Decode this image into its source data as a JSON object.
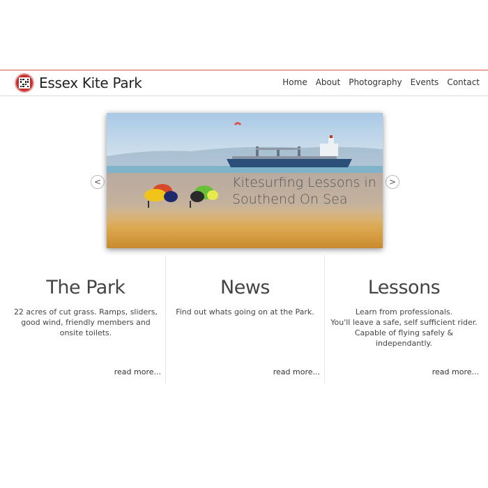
{
  "header": {
    "site_title": "Essex Kite Park",
    "logo_icon": "qr-code-logo-icon",
    "accent_color": "#d9534f",
    "nav": [
      {
        "label": "Home"
      },
      {
        "label": "About"
      },
      {
        "label": "Photography"
      },
      {
        "label": "Events"
      },
      {
        "label": "Contact"
      }
    ]
  },
  "slider": {
    "caption": "Kitesurfing Lessons in Southend On Sea",
    "prev_label": "<",
    "next_label": ">",
    "prev_icon": "chevron-left-icon",
    "next_icon": "chevron-right-icon"
  },
  "columns": [
    {
      "title": "The Park",
      "text": "22 acres of cut grass. Ramps, sliders, good wind, friendly members and onsite toilets.",
      "more": "read more..."
    },
    {
      "title": "News",
      "text": "Find out whats going on at the Park.",
      "more": "read more..."
    },
    {
      "title": "Lessons",
      "text": "Learn from professionals.\nYou'll leave a safe, self sufficient rider.\nCapable of flying safely & independantly.",
      "more": "read more..."
    }
  ]
}
